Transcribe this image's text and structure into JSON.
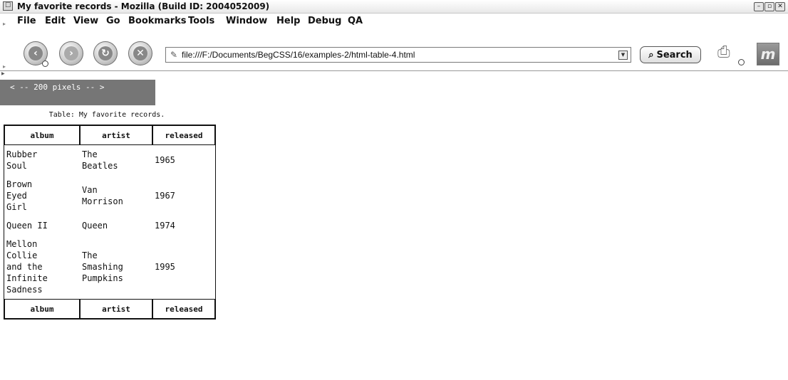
{
  "window": {
    "title": "My favorite records - Mozilla (Build ID: 2004052009)"
  },
  "menubar": {
    "items": [
      "File",
      "Edit",
      "View",
      "Go",
      "Bookmarks",
      "Tools",
      "Window",
      "Help",
      "Debug",
      "QA"
    ]
  },
  "navigation": {
    "url": "file:///F:/Documents/BegCSS/16/examples-2/html-table-4.html",
    "search_label": "Search"
  },
  "page": {
    "pixel_bar": "< -- 200 pixels -- >",
    "caption": "Table: My favorite records.",
    "headers": [
      "album",
      "artist",
      "released"
    ],
    "rows": [
      [
        "Rubber\nSoul",
        "The\nBeatles",
        "1965"
      ],
      [
        "Brown\nEyed\nGirl",
        "Van\nMorrison",
        "1967"
      ],
      [
        "Queen II",
        "Queen",
        "1974"
      ],
      [
        "Mellon\nCollie\nand the\nInfinite\nSadness",
        "The\nSmashing\nPumpkins",
        "1995"
      ]
    ],
    "footers": [
      "album",
      "artist",
      "released"
    ]
  }
}
